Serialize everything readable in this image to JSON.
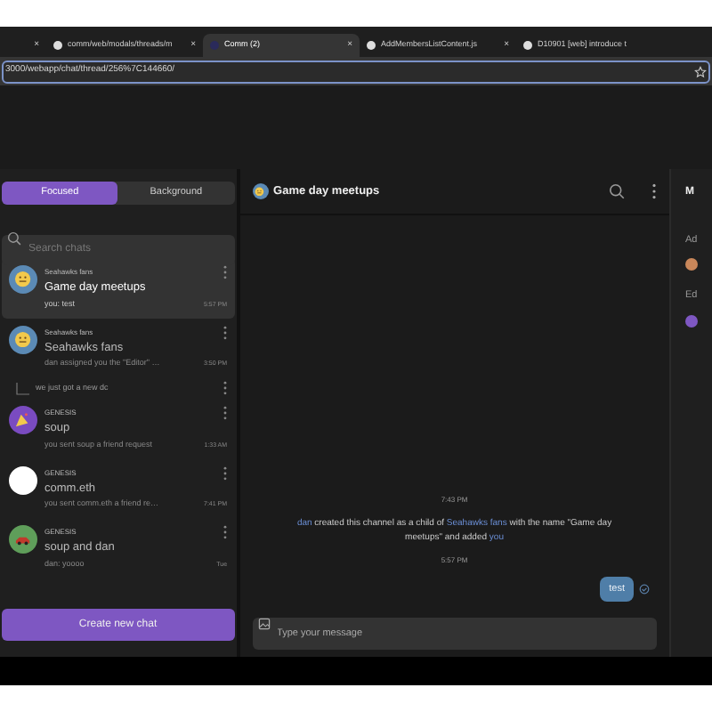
{
  "browser": {
    "tabs": [
      {
        "selected": false
      },
      {
        "title": "comm/web/modals/threads/m",
        "selected": false
      },
      {
        "title": "Comm (2)",
        "selected": true
      },
      {
        "title": "AddMembersListContent.js",
        "selected": false
      },
      {
        "title": "D10901 [web] introduce t",
        "selected": false
      }
    ],
    "close_glyph": "×",
    "address": "3000/webapp/chat/thread/256%7C144660/"
  },
  "sidebar": {
    "tabs": [
      {
        "label": "Focused",
        "selected": true
      },
      {
        "label": "Background",
        "selected": false
      }
    ],
    "search": {
      "placeholder": "Search chats"
    },
    "chats": [
      {
        "kind": "emoji",
        "community": "Seahawks fans",
        "name": "Game day meetups",
        "preview": "you: test",
        "time": "5:57 PM",
        "selected": true
      },
      {
        "kind": "emoji",
        "community": "Seahawks fans",
        "name": "Seahawks fans",
        "preview": "dan assigned you the \"Editor\" …",
        "time": "3:50 PM",
        "selected": false,
        "subthread": "we just got a new dc"
      },
      {
        "kind": "party",
        "community": "GENESIS",
        "name": "soup",
        "preview": "you sent soup a friend request",
        "time": "1:33 AM",
        "selected": false
      },
      {
        "kind": "plain",
        "community": "GENESIS",
        "name": "comm.eth",
        "preview": "you sent comm.eth a friend re…",
        "time": "7:41 PM",
        "selected": false
      },
      {
        "kind": "car",
        "community": "GENESIS",
        "name": "soup and dan",
        "preview": "dan: yoooo",
        "time": "Tue",
        "selected": false
      }
    ],
    "create_button": "Create new chat"
  },
  "thread": {
    "title": "Game day meetups",
    "messages": [
      {
        "kind": "time",
        "text": "7:43 PM"
      },
      {
        "kind": "system",
        "parts": [
          {
            "kind": "link",
            "text": "dan"
          },
          {
            "kind": "text",
            "text": " created this channel as a child of "
          },
          {
            "kind": "link",
            "text": "Seahawks fans"
          },
          {
            "kind": "text",
            "text": " with the name \"Game day meetups\" and added "
          },
          {
            "kind": "link",
            "text": "you"
          }
        ]
      },
      {
        "kind": "time",
        "text": "5:57 PM"
      },
      {
        "kind": "own",
        "text": "test"
      }
    ],
    "composer": {
      "placeholder": "Type your message"
    }
  },
  "right_panel": {
    "title": "M",
    "section_1": "Ad",
    "section_2": "Ed"
  }
}
